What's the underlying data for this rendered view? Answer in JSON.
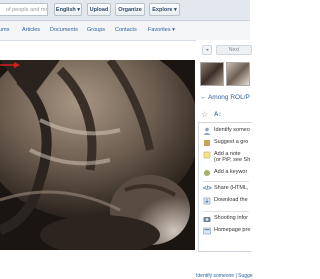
{
  "topbar": {
    "search_placeholder": "of people and more...",
    "buttons": [
      "English ▾",
      "Upload",
      "Organize",
      "Explore ▾"
    ]
  },
  "nav": {
    "items": [
      "ums",
      "Articles",
      "Documents",
      "Groups",
      "Contacts",
      "Favorites ▾"
    ]
  },
  "sidebar": {
    "prev_label": "◂",
    "next_label": "Next",
    "among_label": "← Among ROL/P",
    "menu": [
      {
        "l1": "Identify someo",
        "l2": ""
      },
      {
        "l1": "Suggest a gro",
        "l2": ""
      },
      {
        "l1": "Add a note",
        "l2": "(or PiP, see Sh"
      },
      {
        "l1": "Add a keywor",
        "l2": ""
      },
      {
        "l1": "Share (HTML,",
        "l2": ""
      },
      {
        "l1": "Download the",
        "l2": ""
      },
      {
        "l1": "Shooting infor",
        "l2": ""
      },
      {
        "l1": "Homepage pre",
        "l2": ""
      }
    ],
    "footer": "Identify someone | Sugge"
  },
  "colors": {
    "accent": "#2f5fa0",
    "arrow": "#d42020"
  }
}
